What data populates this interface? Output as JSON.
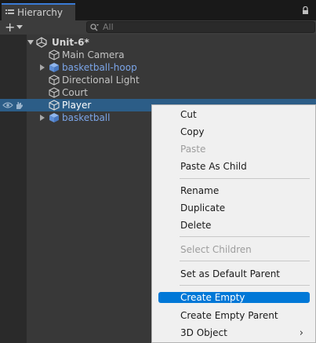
{
  "window": {
    "tab_title": "Hierarchy",
    "tab_icon": "list-icon",
    "lock_icon": "lock-icon"
  },
  "toolbar": {
    "create_label": "+",
    "search_placeholder": "All"
  },
  "hierarchy": {
    "scene": {
      "label": "Unit-6*",
      "icon": "unity-scene-icon"
    },
    "items": [
      {
        "label": "Main Camera",
        "kind": "gameobject"
      },
      {
        "label": "basketball-hoop",
        "kind": "prefab"
      },
      {
        "label": "Directional Light",
        "kind": "gameobject"
      },
      {
        "label": "Court",
        "kind": "gameobject"
      },
      {
        "label": "Player",
        "kind": "gameobject"
      },
      {
        "label": "basketball",
        "kind": "prefab"
      }
    ]
  },
  "context_menu": {
    "items": [
      {
        "label": "Cut",
        "state": "enabled"
      },
      {
        "label": "Copy",
        "state": "enabled"
      },
      {
        "label": "Paste",
        "state": "disabled"
      },
      {
        "label": "Paste As Child",
        "state": "enabled"
      },
      {
        "label": "Rename",
        "state": "enabled"
      },
      {
        "label": "Duplicate",
        "state": "enabled"
      },
      {
        "label": "Delete",
        "state": "enabled"
      },
      {
        "label": "Select Children",
        "state": "disabled"
      },
      {
        "label": "Set as Default Parent",
        "state": "enabled"
      },
      {
        "label": "Create Empty",
        "state": "highlighted"
      },
      {
        "label": "Create Empty Parent",
        "state": "enabled"
      },
      {
        "label": "3D Object",
        "state": "enabled",
        "submenu_arrow": "›"
      }
    ]
  },
  "colors": {
    "prefab_text": "#7ba5e8",
    "selection": "#2c5d87",
    "menu_highlight": "#0078d7",
    "tab_accent": "#3a7bd5"
  }
}
